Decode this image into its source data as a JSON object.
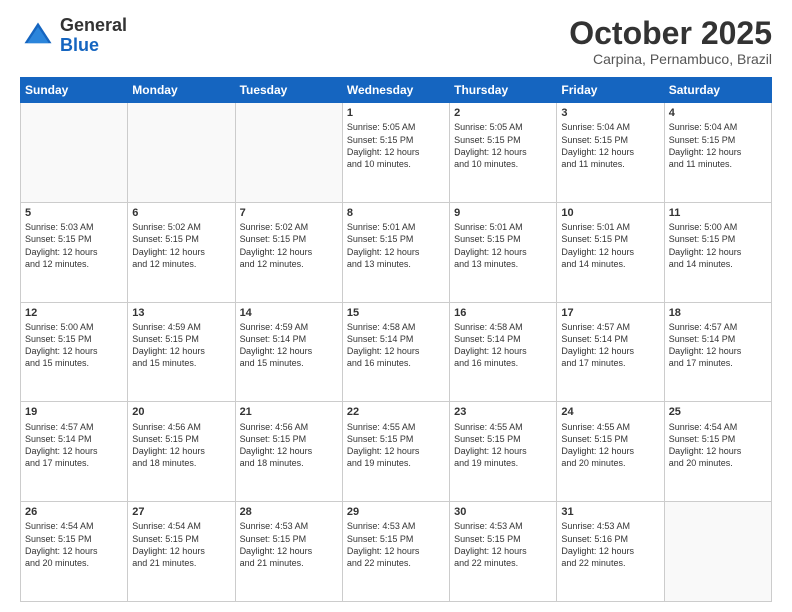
{
  "header": {
    "logo_general": "General",
    "logo_blue": "Blue",
    "month": "October 2025",
    "location": "Carpina, Pernambuco, Brazil"
  },
  "days_of_week": [
    "Sunday",
    "Monday",
    "Tuesday",
    "Wednesday",
    "Thursday",
    "Friday",
    "Saturday"
  ],
  "weeks": [
    [
      {
        "day": "",
        "info": ""
      },
      {
        "day": "",
        "info": ""
      },
      {
        "day": "",
        "info": ""
      },
      {
        "day": "1",
        "info": "Sunrise: 5:05 AM\nSunset: 5:15 PM\nDaylight: 12 hours\nand 10 minutes."
      },
      {
        "day": "2",
        "info": "Sunrise: 5:05 AM\nSunset: 5:15 PM\nDaylight: 12 hours\nand 10 minutes."
      },
      {
        "day": "3",
        "info": "Sunrise: 5:04 AM\nSunset: 5:15 PM\nDaylight: 12 hours\nand 11 minutes."
      },
      {
        "day": "4",
        "info": "Sunrise: 5:04 AM\nSunset: 5:15 PM\nDaylight: 12 hours\nand 11 minutes."
      }
    ],
    [
      {
        "day": "5",
        "info": "Sunrise: 5:03 AM\nSunset: 5:15 PM\nDaylight: 12 hours\nand 12 minutes."
      },
      {
        "day": "6",
        "info": "Sunrise: 5:02 AM\nSunset: 5:15 PM\nDaylight: 12 hours\nand 12 minutes."
      },
      {
        "day": "7",
        "info": "Sunrise: 5:02 AM\nSunset: 5:15 PM\nDaylight: 12 hours\nand 12 minutes."
      },
      {
        "day": "8",
        "info": "Sunrise: 5:01 AM\nSunset: 5:15 PM\nDaylight: 12 hours\nand 13 minutes."
      },
      {
        "day": "9",
        "info": "Sunrise: 5:01 AM\nSunset: 5:15 PM\nDaylight: 12 hours\nand 13 minutes."
      },
      {
        "day": "10",
        "info": "Sunrise: 5:01 AM\nSunset: 5:15 PM\nDaylight: 12 hours\nand 14 minutes."
      },
      {
        "day": "11",
        "info": "Sunrise: 5:00 AM\nSunset: 5:15 PM\nDaylight: 12 hours\nand 14 minutes."
      }
    ],
    [
      {
        "day": "12",
        "info": "Sunrise: 5:00 AM\nSunset: 5:15 PM\nDaylight: 12 hours\nand 15 minutes."
      },
      {
        "day": "13",
        "info": "Sunrise: 4:59 AM\nSunset: 5:15 PM\nDaylight: 12 hours\nand 15 minutes."
      },
      {
        "day": "14",
        "info": "Sunrise: 4:59 AM\nSunset: 5:14 PM\nDaylight: 12 hours\nand 15 minutes."
      },
      {
        "day": "15",
        "info": "Sunrise: 4:58 AM\nSunset: 5:14 PM\nDaylight: 12 hours\nand 16 minutes."
      },
      {
        "day": "16",
        "info": "Sunrise: 4:58 AM\nSunset: 5:14 PM\nDaylight: 12 hours\nand 16 minutes."
      },
      {
        "day": "17",
        "info": "Sunrise: 4:57 AM\nSunset: 5:14 PM\nDaylight: 12 hours\nand 17 minutes."
      },
      {
        "day": "18",
        "info": "Sunrise: 4:57 AM\nSunset: 5:14 PM\nDaylight: 12 hours\nand 17 minutes."
      }
    ],
    [
      {
        "day": "19",
        "info": "Sunrise: 4:57 AM\nSunset: 5:14 PM\nDaylight: 12 hours\nand 17 minutes."
      },
      {
        "day": "20",
        "info": "Sunrise: 4:56 AM\nSunset: 5:15 PM\nDaylight: 12 hours\nand 18 minutes."
      },
      {
        "day": "21",
        "info": "Sunrise: 4:56 AM\nSunset: 5:15 PM\nDaylight: 12 hours\nand 18 minutes."
      },
      {
        "day": "22",
        "info": "Sunrise: 4:55 AM\nSunset: 5:15 PM\nDaylight: 12 hours\nand 19 minutes."
      },
      {
        "day": "23",
        "info": "Sunrise: 4:55 AM\nSunset: 5:15 PM\nDaylight: 12 hours\nand 19 minutes."
      },
      {
        "day": "24",
        "info": "Sunrise: 4:55 AM\nSunset: 5:15 PM\nDaylight: 12 hours\nand 20 minutes."
      },
      {
        "day": "25",
        "info": "Sunrise: 4:54 AM\nSunset: 5:15 PM\nDaylight: 12 hours\nand 20 minutes."
      }
    ],
    [
      {
        "day": "26",
        "info": "Sunrise: 4:54 AM\nSunset: 5:15 PM\nDaylight: 12 hours\nand 20 minutes."
      },
      {
        "day": "27",
        "info": "Sunrise: 4:54 AM\nSunset: 5:15 PM\nDaylight: 12 hours\nand 21 minutes."
      },
      {
        "day": "28",
        "info": "Sunrise: 4:53 AM\nSunset: 5:15 PM\nDaylight: 12 hours\nand 21 minutes."
      },
      {
        "day": "29",
        "info": "Sunrise: 4:53 AM\nSunset: 5:15 PM\nDaylight: 12 hours\nand 22 minutes."
      },
      {
        "day": "30",
        "info": "Sunrise: 4:53 AM\nSunset: 5:15 PM\nDaylight: 12 hours\nand 22 minutes."
      },
      {
        "day": "31",
        "info": "Sunrise: 4:53 AM\nSunset: 5:16 PM\nDaylight: 12 hours\nand 22 minutes."
      },
      {
        "day": "",
        "info": ""
      }
    ]
  ]
}
